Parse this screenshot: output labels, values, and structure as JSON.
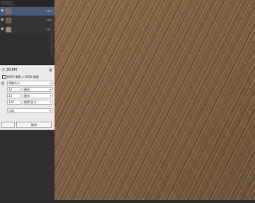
{
  "panel": {
    "tabs": [
      "",
      "",
      "",
      "",
      ""
    ],
    "layers": [
      {
        "name": "",
        "meta": "Lüm",
        "selected": true
      },
      {
        "name": "",
        "meta": "Lüm",
        "selected": false
      },
      {
        "name": "",
        "meta": "Lüm",
        "selected": false
      }
    ]
  },
  "dialog": {
    "title": "小 38.8M",
    "ratio_text": "6090 像素 × 6090 像素",
    "fit_label": "图",
    "fit_value": "原稿大小",
    "width_value": "33",
    "width_unit": "厘米",
    "height_value": "33",
    "height_unit": "厘米",
    "resolution_value": "120",
    "resolution_unit": "像素/英寸",
    "resample_value": "自动",
    "ok_label": "",
    "cancel_label": "取消"
  }
}
